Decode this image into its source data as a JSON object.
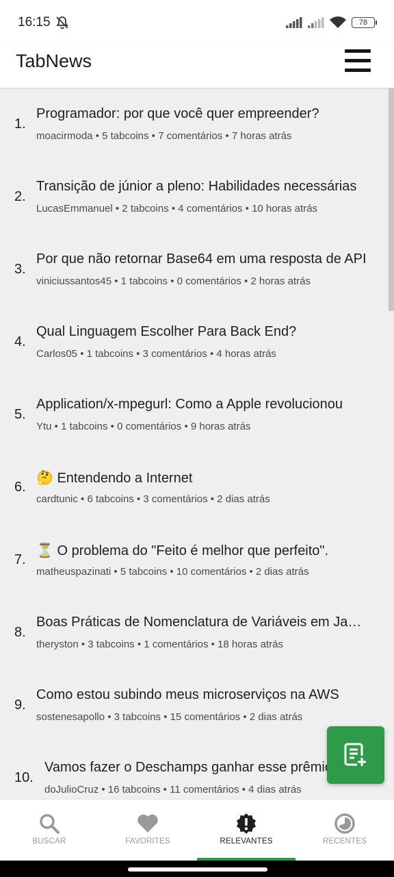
{
  "status": {
    "time": "16:15",
    "battery": "78"
  },
  "app": {
    "title": "TabNews"
  },
  "articles": [
    {
      "num": "1.",
      "title": "Programador: por que você quer empreender?",
      "meta": "moacirmoda • 5 tabcoins • 7 comentários • 7 horas atrás"
    },
    {
      "num": "2.",
      "title": "Transição de júnior a pleno: Habilidades necessárias",
      "meta": "LucasEmmanuel • 2 tabcoins • 4 comentários • 10 horas atrás"
    },
    {
      "num": "3.",
      "title": "Por que não retornar Base64 em uma resposta de API",
      "meta": "viniciussantos45 • 1 tabcoins • 0 comentários • 2 horas atrás"
    },
    {
      "num": "4.",
      "title": "Qual Linguagem Escolher Para Back End?",
      "meta": "Carlos05 • 1 tabcoins • 3 comentários • 4 horas atrás"
    },
    {
      "num": "5.",
      "title": "Application/x-mpegurl: Como a Apple revolucionou",
      "meta": "Ytu • 1 tabcoins • 0 comentários • 9 horas atrás"
    },
    {
      "num": "6.",
      "title": "🤔 Entendendo a Internet",
      "meta": "cardtunic • 6 tabcoins • 3 comentários • 2 dias atrás"
    },
    {
      "num": "7.",
      "title": "⏳ O problema do \"Feito é melhor que perfeito\".",
      "meta": "matheuspazinati • 5 tabcoins • 10 comentários • 2 dias atrás"
    },
    {
      "num": "8.",
      "title": "Boas Práticas de Nomenclatura de Variáveis em JavaScript",
      "meta": "theryston • 3 tabcoins • 1 comentários • 18 horas atrás"
    },
    {
      "num": "9.",
      "title": "Como estou subindo meus microserviços na AWS",
      "meta": "sostenesapollo • 3 tabcoins • 15 comentários • 2 dias atrás"
    },
    {
      "num": "10.",
      "title": "Vamos fazer o Deschamps ganhar esse prêmio",
      "meta": "doJulioCruz • 16 tabcoins • 11 comentários • 4 dias atrás"
    }
  ],
  "nav": [
    {
      "label": "BUSCAR",
      "icon": "search-icon"
    },
    {
      "label": "FAVORITES",
      "icon": "heart-icon"
    },
    {
      "label": "RELEVANTES",
      "icon": "alert-badge-icon",
      "active": true
    },
    {
      "label": "RECENTES",
      "icon": "clock-icon"
    }
  ],
  "colors": {
    "accent": "#2f9b4a",
    "background": "#efefef"
  }
}
